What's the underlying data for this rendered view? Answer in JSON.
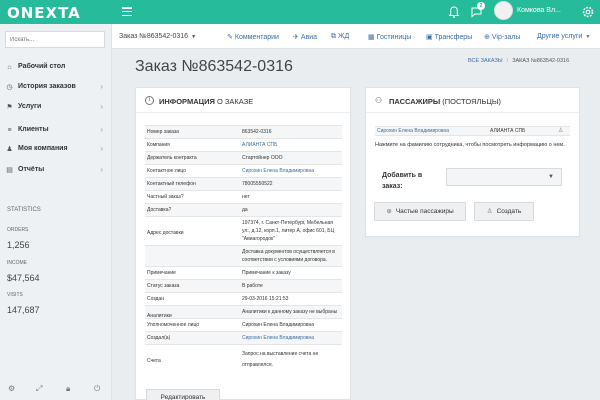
{
  "topbar": {
    "logo": "ONEXTA",
    "notifications_count": "2",
    "user_name": "Комкова Вл...",
    "icons": [
      "menu-icon",
      "bell-icon",
      "chat-icon",
      "gear-icon"
    ],
    "accent": "#26bb9a"
  },
  "sidebar": {
    "search_placeholder": "Искать...",
    "items": [
      {
        "icon": "home-icon",
        "label": "Рабочий стол"
      },
      {
        "icon": "history-icon",
        "label": "История заказов"
      },
      {
        "icon": "services-icon",
        "label": "Услуги"
      },
      {
        "icon": "clients-icon",
        "label": "Клиенты"
      },
      {
        "icon": "company-icon",
        "label": "Моя компания"
      },
      {
        "icon": "reports-icon",
        "label": "Отчёты"
      }
    ],
    "stats_title": "STATISTICS",
    "stats": [
      {
        "label": "ORDERS",
        "value": "1,256"
      },
      {
        "label": "INCOME",
        "value": "$47,564"
      },
      {
        "label": "VISITS",
        "value": "147,687"
      }
    ]
  },
  "orderbar": {
    "order_select": "Заказ №863542-0316",
    "tabs": [
      {
        "icon": "comments-icon",
        "label": "Комментарии"
      },
      {
        "icon": "plane-icon",
        "label": "Авиа"
      },
      {
        "icon": "train-icon",
        "label": "ЖД"
      },
      {
        "icon": "hotel-icon",
        "label": "Гостиницы"
      },
      {
        "icon": "transfer-icon",
        "label": "Трансферы"
      },
      {
        "icon": "vip-icon",
        "label": "Vip-залы"
      },
      {
        "icon": "chevron-down-icon",
        "label": "Другие услуги"
      }
    ]
  },
  "page": {
    "title": "Заказ №863542-0316",
    "breadcrumb_link": "ВСЕ ЗАКАЗЫ",
    "breadcrumb_current": "ЗАКАЗ №863542-0316"
  },
  "info_panel": {
    "title_bold": "ИНФОРМАЦИЯ",
    "title_rest": " О ЗАКАЗЕ",
    "rows": [
      {
        "k": "Номер заказа",
        "v": "863542-0316"
      },
      {
        "k": "Компания",
        "v": "АЛИАНТА СПБ"
      },
      {
        "k": "Держатель контракта",
        "v": "Стартойнер ООО"
      },
      {
        "k": "Контактное лицо",
        "v": "Сирохин Елена Владимировна"
      },
      {
        "k": "Контактный телефон",
        "v": "78005550522"
      },
      {
        "k": "Частный заказ?",
        "v": "нет"
      },
      {
        "k": "Доставка?",
        "v": "да"
      },
      {
        "k": "Адрес доставки",
        "v": "197374, г. Санкт-Петербург, Мебельная ул., д.12, корп.1, литер А, офис 601, БЦ \"Авиагородок\""
      },
      {
        "k": "",
        "v": "Доставка документов осуществляется в соответствии с условиями договора."
      },
      {
        "k": "Примечание",
        "v": "Примечание к заказу"
      },
      {
        "k": "Статус заказа",
        "v": "В работе"
      },
      {
        "k": "Создан",
        "v": "29-03-2016 15:21:53"
      },
      {
        "k": "Аналитики",
        "v": "Аналитики к данному заказу не выбраны"
      },
      {
        "k": "Уполномоченное лицо",
        "v": "Сирохин Елена Владимировна"
      },
      {
        "k": "Создал(а)",
        "v": "Сирохин Елена Владимировна"
      },
      {
        "k": "Счета",
        "v": "Запрос на выставление счета не отправлялся."
      }
    ],
    "edit_button": "Редактировать"
  },
  "passengers_panel": {
    "title_bold": "ПАССАЖИРЫ",
    "title_rest": " (ПОСТОЯЛЬЦЫ)",
    "passenger_name": "Сирохин Елена Владимировна",
    "passenger_company": "АЛИАНТА СПБ",
    "hint": "Нажмите на фамилию сотрудника, чтобы посмотреть информацию о нем.",
    "add_label": "Добавить в заказ:",
    "frequent_button": "Частые пассажиры",
    "create_button": "Создать"
  }
}
